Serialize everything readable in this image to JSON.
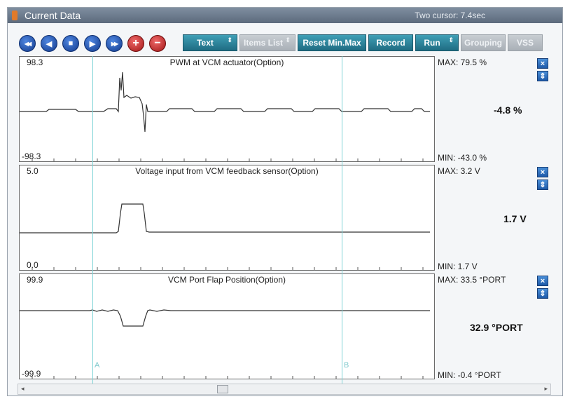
{
  "window": {
    "title": "Current Data",
    "cursor_info": "Two cursor: 7.4sec"
  },
  "toolbar": {
    "nav": [
      {
        "name": "rewind-icon",
        "glyph": "◀◀"
      },
      {
        "name": "previous-icon",
        "glyph": "◀"
      },
      {
        "name": "stop-icon",
        "glyph": "■"
      },
      {
        "name": "next-icon",
        "glyph": "▶"
      },
      {
        "name": "fast-forward-icon",
        "glyph": "▶▶"
      },
      {
        "name": "add-icon",
        "glyph": "+"
      },
      {
        "name": "remove-icon",
        "glyph": "−"
      }
    ],
    "text_label": "Text",
    "items_list_label": "Items List",
    "reset_label": "Reset Min.Max",
    "record_label": "Record",
    "run_label": "Run",
    "grouping_label": "Grouping",
    "vss_label": "VSS",
    "spin_icon": "⇕"
  },
  "panels": [
    {
      "title": "PWM at VCM actuator(Option)",
      "ymax_label": "98.3",
      "ymin_label": "-98.3",
      "max_text": "MAX:  79.5 %",
      "min_text": "MIN: -43.0 %",
      "current": "-4.8 %"
    },
    {
      "title": "Voltage input from VCM feedback sensor(Option)",
      "ymax_label": "5.0",
      "ymin_label": "0.0",
      "max_text": "MAX:   3.2 V",
      "min_text": "MIN:   1.7 V",
      "current": "1.7 V"
    },
    {
      "title": "VCM Port Flap Position(Option)",
      "ymax_label": "99.9",
      "ymin_label": "-99.9",
      "max_text": "MAX:  33.5 °PORT",
      "min_text": "MIN:  -0.4 °PORT",
      "current": "32.9 °PORT"
    }
  ],
  "panel_buttons": {
    "close": "×",
    "expand": "⇕"
  },
  "cursors": {
    "a_label": "A",
    "b_label": "B"
  },
  "scroll": {
    "left": "◂",
    "right": "▸"
  }
}
